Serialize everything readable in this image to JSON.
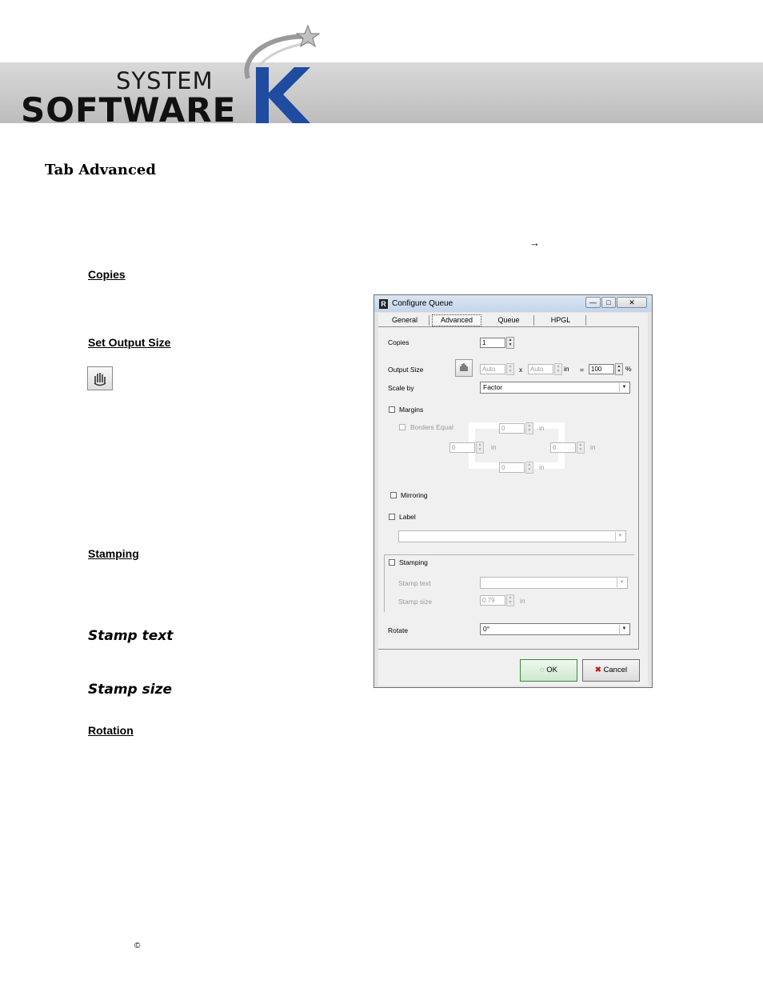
{
  "header": {
    "logo_system": "SYSTEM",
    "logo_software": "SOFTWARE",
    "logo_k": "K",
    "colors": {
      "brand_blue": "#1f4ba0",
      "banner_grey": "#c8c8c8"
    }
  },
  "page_title": "Tab Advanced",
  "arrow_glyph": "→",
  "sections": {
    "copies": "Copies",
    "output_size": "Set Output Size",
    "stamping": "Stamping",
    "stamp_text": "Stamp text",
    "stamp_size": "Stamp size",
    "rotation": "Rotation"
  },
  "toolbar_icon": "hand-icon",
  "footer": {
    "copyright": "©"
  },
  "dialog": {
    "title": "Configure Queue",
    "window_buttons": {
      "minimize": "—",
      "maximize": "□",
      "close": "✕"
    },
    "tabs": [
      "General",
      "Advanced",
      "Queue",
      "HPGL"
    ],
    "active_tab": "Advanced",
    "copies": {
      "label": "Copies",
      "value": "1"
    },
    "output_size": {
      "label": "Output Size",
      "width": "Auto",
      "x": "x",
      "height": "Auto",
      "unit": "in",
      "eq": "=",
      "percent": "100",
      "percent_sign": "%"
    },
    "scale_by": {
      "label": "Scale by",
      "value": "Factor"
    },
    "margins": {
      "label": "Margins",
      "borders_equal": "Borders Equal",
      "top": "0",
      "left": "0",
      "right": "0",
      "bottom": "0",
      "unit": "in"
    },
    "mirroring": {
      "label": "Mirroring"
    },
    "label": {
      "label": "Label",
      "value": ""
    },
    "stamping": {
      "label": "Stamping",
      "stamp_text_label": "Stamp text",
      "stamp_text_value": "",
      "stamp_size_label": "Stamp size",
      "stamp_size_value": "0.79",
      "unit": "in"
    },
    "rotate": {
      "label": "Rotate",
      "value": "0°"
    },
    "buttons": {
      "ok": "OK",
      "cancel": "Cancel"
    }
  }
}
